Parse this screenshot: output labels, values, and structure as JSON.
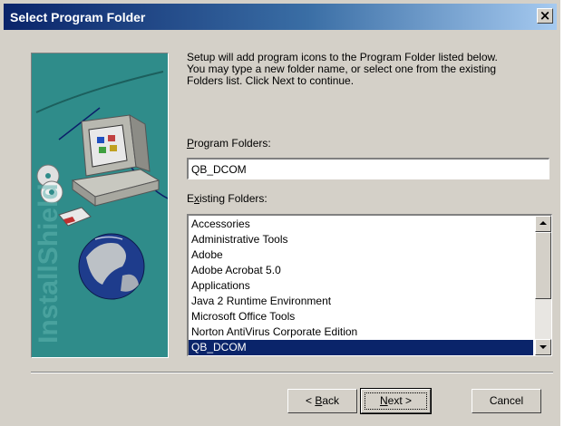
{
  "window": {
    "title": "Select Program Folder",
    "close_glyph": "×"
  },
  "art": {
    "watermark": "InstallShield"
  },
  "description": "Setup will add program icons to the Program Folder listed below.\nYou may type a new folder name, or select one from the existing\nFolders list.  Click Next to continue.",
  "program_folders": {
    "label_accel": "P",
    "label_rest": "rogram Folders:",
    "value": "QB_DCOM"
  },
  "existing_folders": {
    "label_first": "E",
    "label_accel": "x",
    "label_rest": "isting Folders:",
    "items": [
      "Accessories",
      "Administrative Tools",
      "Adobe",
      "Adobe Acrobat 5.0",
      "Applications",
      "Java 2 Runtime Environment",
      "Microsoft Office Tools",
      "Norton AntiVirus Corporate Edition",
      "QB_DCOM"
    ],
    "selected": "QB_DCOM"
  },
  "buttons": {
    "back_prefix": "< ",
    "back_accel": "B",
    "back_rest": "ack",
    "next_accel": "N",
    "next_rest": "ext >",
    "cancel": "Cancel"
  },
  "colors": {
    "title_gradient_start": "#0a246a",
    "dialog_face": "#d4d0c8",
    "art_background": "#2f8c8a",
    "selection": "#0a246a"
  }
}
